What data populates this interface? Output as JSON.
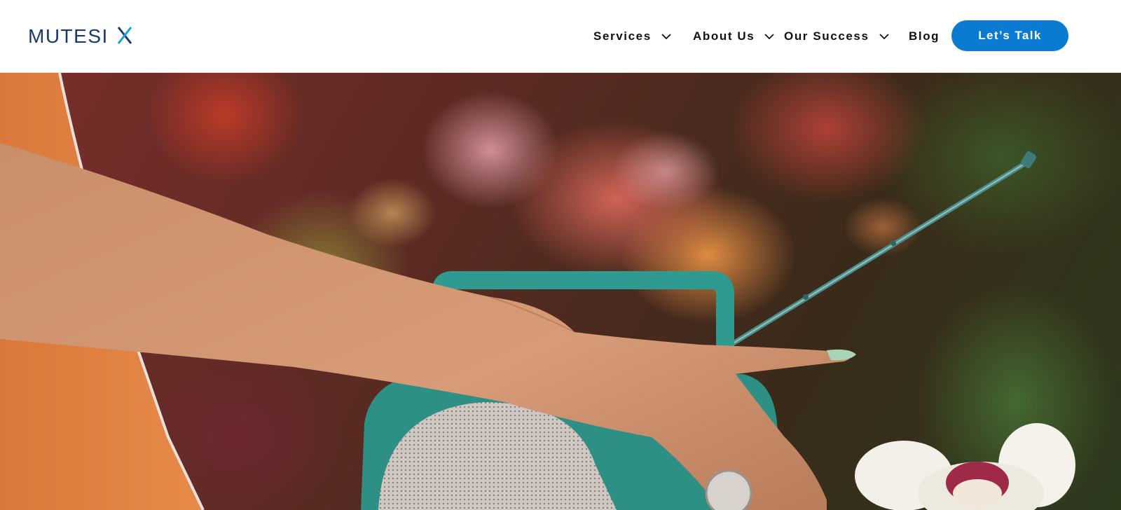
{
  "brand": {
    "name": "MUTESIX",
    "wordmark_color": "#1a3a6b",
    "accent_color": "#1aa0d8"
  },
  "nav": {
    "items": [
      {
        "label": "Services",
        "has_dropdown": true
      },
      {
        "label": "About Us",
        "has_dropdown": true
      },
      {
        "label": "Our Success",
        "has_dropdown": true
      },
      {
        "label": "Blog",
        "has_dropdown": false
      }
    ],
    "cta_label": "Let’s Talk",
    "cta_color": "#0a7bd0"
  },
  "hero": {
    "media": "video-still",
    "subject_icons": [
      "hand",
      "retro-radio",
      "antenna",
      "orchid"
    ]
  }
}
